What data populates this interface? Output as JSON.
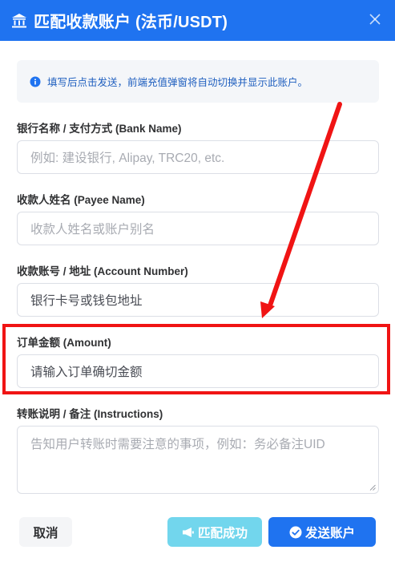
{
  "header": {
    "icon": "bank-icon",
    "title": "匹配收款账户 (法币/USDT)",
    "close_icon": "close-icon"
  },
  "notice": {
    "icon": "info-icon",
    "text": "填写后点击发送，前端充值弹窗将自动切换并显示此账户。"
  },
  "fields": {
    "bank_name": {
      "label": "银行名称 / 支付方式 (Bank Name)",
      "placeholder": "例如: 建设银行, Alipay, TRC20, etc."
    },
    "payee_name": {
      "label": "收款人姓名 (Payee Name)",
      "placeholder": "收款人姓名或账户别名"
    },
    "account_number": {
      "label": "收款账号 / 地址 (Account Number)",
      "placeholder": "银行卡号或钱包地址"
    },
    "amount": {
      "label": "订单金额 (Amount)",
      "placeholder": "请输入订单确切金额"
    },
    "instructions": {
      "label": "转账说明 / 备注 (Instructions)",
      "placeholder": "告知用户转账时需要注意的事项，例如：务必备注UID"
    }
  },
  "buttons": {
    "cancel": "取消",
    "match_success": "匹配成功",
    "match_icon": "megaphone-icon",
    "send_account": "发送账户",
    "send_icon": "check-circle-icon"
  },
  "colors": {
    "primary": "#1f73f0",
    "highlight": "#f01414",
    "match_button": "#5ad0ea"
  }
}
